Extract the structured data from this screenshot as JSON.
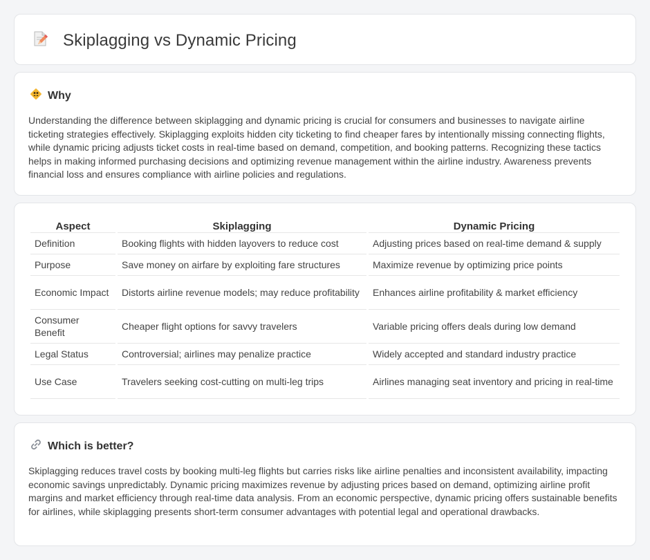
{
  "page": {
    "title": "Skiplagging vs Dynamic Pricing",
    "title_icon": "memo-pencil-icon"
  },
  "why": {
    "icon": "diamond-people-icon",
    "title": "Why",
    "text": "Understanding the difference between skiplagging and dynamic pricing is crucial for consumers and businesses to navigate airline ticketing strategies effectively. Skiplagging exploits hidden city ticketing to find cheaper fares by intentionally missing connecting flights, while dynamic pricing adjusts ticket costs in real-time based on demand, competition, and booking patterns. Recognizing these tactics helps in making informed purchasing decisions and optimizing revenue management within the airline industry. Awareness prevents financial loss and ensures compliance with airline policies and regulations."
  },
  "comparison": {
    "headers": [
      "Aspect",
      "Skiplagging",
      "Dynamic Pricing"
    ],
    "rows": [
      [
        "Definition",
        "Booking flights with hidden layovers to reduce cost",
        "Adjusting prices based on real-time demand & supply"
      ],
      [
        "Purpose",
        "Save money on airfare by exploiting fare structures",
        "Maximize revenue by optimizing price points"
      ],
      [
        "Economic Impact",
        "Distorts airline revenue models; may reduce profitability",
        "Enhances airline profitability & market efficiency"
      ],
      [
        "Consumer Benefit",
        "Cheaper flight options for savvy travelers",
        "Variable pricing offers deals during low demand"
      ],
      [
        "Legal Status",
        "Controversial; airlines may penalize practice",
        "Widely accepted and standard industry practice"
      ],
      [
        "Use Case",
        "Travelers seeking cost-cutting on multi-leg trips",
        "Airlines managing seat inventory and pricing in real-time"
      ]
    ]
  },
  "better": {
    "icon": "link-icon",
    "title": "Which is better?",
    "text": "Skiplagging reduces travel costs by booking multi-leg flights but carries risks like airline penalties and inconsistent availability, impacting economic savings unpredictably. Dynamic pricing maximizes revenue by adjusting prices based on demand, optimizing airline profit margins and market efficiency through real-time data analysis. From an economic perspective, dynamic pricing offers sustainable benefits for airlines, while skiplagging presents short-term consumer advantages with potential legal and operational drawbacks."
  }
}
